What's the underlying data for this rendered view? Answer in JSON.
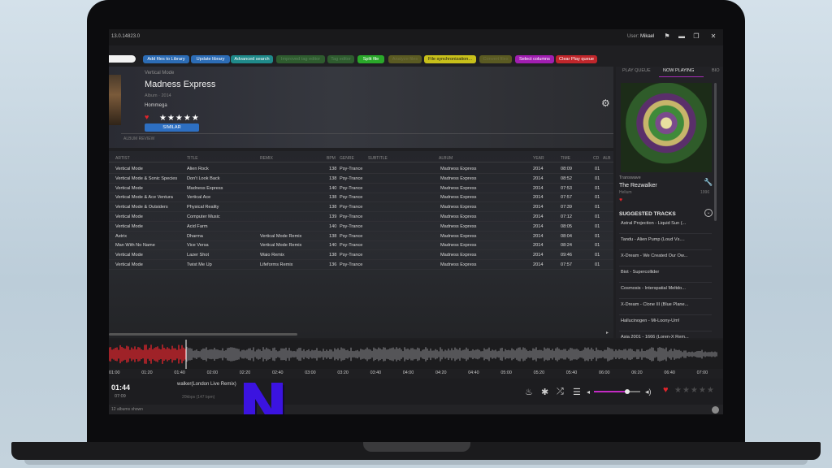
{
  "app": {
    "version": "13.0.14823.0",
    "user_prefix": "User:",
    "user_name": "Mikael"
  },
  "toolbar": [
    {
      "label": "Add files to Library",
      "style": "tb-blue"
    },
    {
      "label": "Update library",
      "style": "tb-blue"
    },
    {
      "label": "Advanced search",
      "style": "tb-teal"
    },
    {
      "label": "Improved tag editor",
      "style": "tb-dkgreen"
    },
    {
      "label": "Tag editor",
      "style": "tb-dkgreen"
    },
    {
      "label": "Split file",
      "style": "tb-green"
    },
    {
      "label": "Analyze files",
      "style": "tb-olive"
    },
    {
      "label": "File synchronization...",
      "style": "tb-yellow"
    },
    {
      "label": "Convert files",
      "style": "tb-olive"
    },
    {
      "label": "Select columns",
      "style": "tb-purple"
    },
    {
      "label": "Clear Play queue",
      "style": "tb-red"
    }
  ],
  "album": {
    "artist": "Vertical Mode",
    "title": "Madness Express",
    "meta": "Album · 2014",
    "label": "Hommega",
    "rating_text": "★★★★★",
    "similar_label": "SIMILAR",
    "review_label": "ALBUM REVIEW"
  },
  "table": {
    "columns": [
      "ARTIST",
      "TITLE",
      "REMIX",
      "BPM",
      "GENRE",
      "SUBTITLE",
      "ALBUM",
      "YEAR",
      "TIME",
      "CD",
      "ALB"
    ],
    "rows": [
      [
        "Vertical Mode",
        "Alien Rock",
        "",
        "138",
        "Psy-Trance",
        "",
        "Madness Express",
        "2014",
        "08:09",
        "01"
      ],
      [
        "Vertical Mode & Sonic Species",
        "Don't Look Back",
        "",
        "138",
        "Psy-Trance",
        "",
        "Madness Express",
        "2014",
        "08:52",
        "01"
      ],
      [
        "Vertical Mode",
        "Madness Express",
        "",
        "140",
        "Psy-Trance",
        "",
        "Madness Express",
        "2014",
        "07:53",
        "01"
      ],
      [
        "Vertical Mode & Ace Ventura",
        "Vertical Ace",
        "",
        "138",
        "Psy-Trance",
        "",
        "Madness Express",
        "2014",
        "07:57",
        "01"
      ],
      [
        "Vertical Mode & Outsiders",
        "Physical Reality",
        "",
        "138",
        "Psy-Trance",
        "",
        "Madness Express",
        "2014",
        "07:39",
        "01"
      ],
      [
        "Vertical Mode",
        "Computer Music",
        "",
        "139",
        "Psy-Trance",
        "",
        "Madness Express",
        "2014",
        "07:12",
        "01"
      ],
      [
        "Vertical Mode",
        "Acid Farm",
        "",
        "140",
        "Psy-Trance",
        "",
        "Madness Express",
        "2014",
        "08:05",
        "01"
      ],
      [
        "Astrix",
        "Dharma",
        "Vertical Mode Remix",
        "138",
        "Psy-Trance",
        "",
        "Madness Express",
        "2014",
        "08:04",
        "01"
      ],
      [
        "Man With No Name",
        "Vice Versa",
        "Vertical Mode Remix",
        "140",
        "Psy-Trance",
        "",
        "Madness Express",
        "2014",
        "08:24",
        "01"
      ],
      [
        "Vertical Mode",
        "Lazer Shot",
        "Waio Remix",
        "138",
        "Psy-Trance",
        "",
        "Madness Express",
        "2014",
        "09:46",
        "01"
      ],
      [
        "Vertical Mode",
        "Twist Me Up",
        "Lifeforms Remix",
        "136",
        "Psy-Trance",
        "",
        "Madness Express",
        "2014",
        "07:57",
        "01"
      ]
    ]
  },
  "right_panel": {
    "tabs": [
      "PLAY QUEUE",
      "NOW PLAYING",
      "BIO"
    ],
    "now_playing_label": "Transwave",
    "track": "The Rezwalker",
    "artist": "Helium",
    "year": "1996",
    "suggested_header": "SUGGESTED TRACKS",
    "suggested": [
      "Astral Projection  -  Liquid Sun (...",
      "Tandu  -  Alien Pump (Loud Vs....",
      "X-Dream  -  We Created Our Ow...",
      "Biot  -  Supercollider",
      "Cosmosis  -  Interspatial Meltdo...",
      "X-Dream  -  Clone III (Blue Plane...",
      "Hallucinogen  -  Mi-Loony-Um!",
      "Asia 2001  -  1666 (Loren-X Rem..."
    ]
  },
  "timeline": [
    "01:00",
    "01:20",
    "01:40",
    "02:00",
    "02:20",
    "02:40",
    "03:00",
    "03:20",
    "03:40",
    "04:00",
    "04:20",
    "04:40",
    "05:00",
    "05:20",
    "05:40",
    "06:00",
    "06:20",
    "06:40",
    "07:00"
  ],
  "player": {
    "current_time": "01:44",
    "total_time": "07:09",
    "track_name": "walker(London Live Remix)",
    "bitrate": "20kbps (147 bpm)",
    "volume": 0.72,
    "rating_stars": "★★★★★"
  },
  "status": {
    "text": "12 albums shown"
  },
  "colors": {
    "accent": "#c32bc3",
    "heart": "#e0242b",
    "logo": "#3b13e0"
  }
}
